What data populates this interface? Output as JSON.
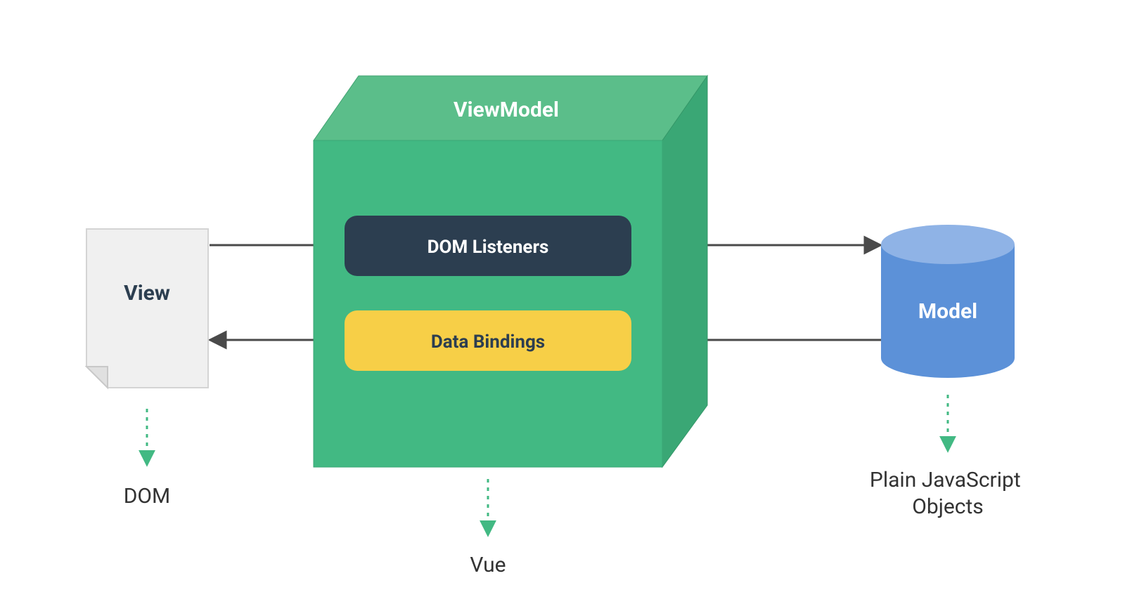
{
  "diagram": {
    "view": {
      "title": "View",
      "caption": "DOM"
    },
    "viewmodel": {
      "title": "ViewModel",
      "listeners": "DOM Listeners",
      "bindings": "Data Bindings",
      "caption": "Vue"
    },
    "model": {
      "title": "Model",
      "caption": "Plain JavaScript\nObjects"
    },
    "colors": {
      "cubeTop": "#5BBE8A",
      "cubeFront": "#42b983",
      "cubeSide": "#3aa775",
      "listenersBox": "#2c3e50",
      "bindingsBox": "#f7cf47",
      "viewBg": "#f0f0f0",
      "viewText": "#2c3e50",
      "modelTop": "#719fdd",
      "modelBody": "#5c91d8",
      "arrow": "#4a4a4a",
      "dottedArrow": "#42b983",
      "caption": "#333333"
    }
  }
}
